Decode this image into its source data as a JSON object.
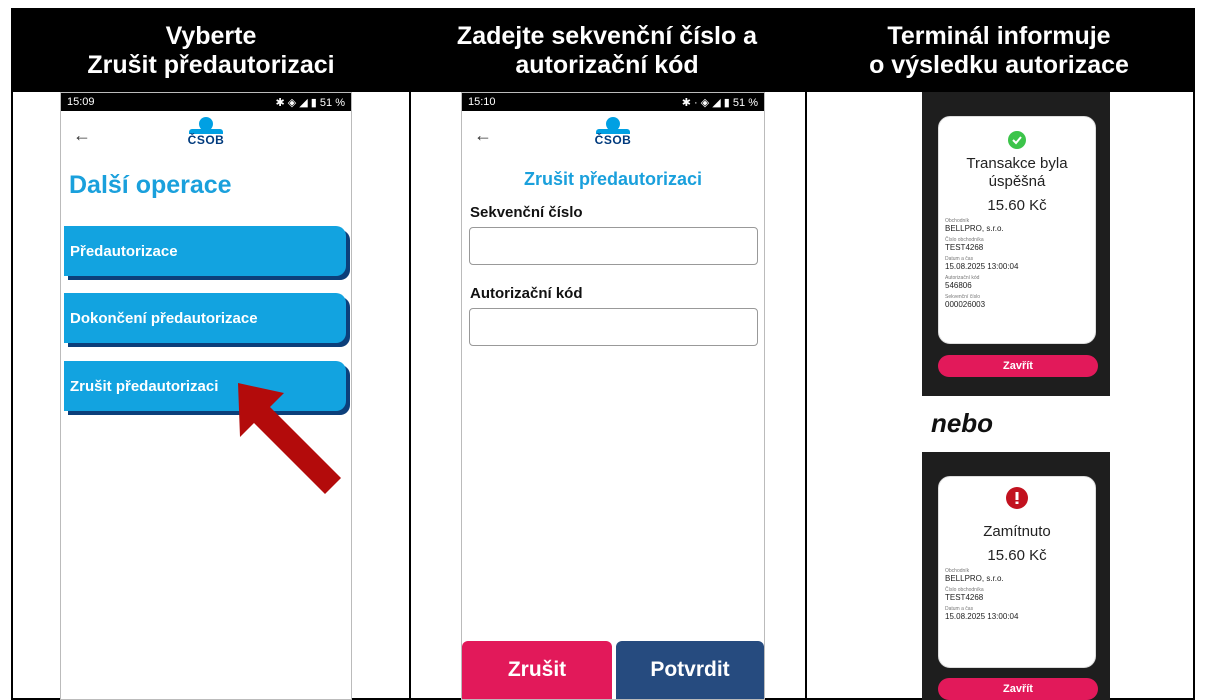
{
  "columns": {
    "col1": {
      "line1": "Vyberte",
      "line2": "Zrušit předautorizaci"
    },
    "col2": {
      "line1": "Zadejte sekvenční číslo a",
      "line2": "autorizační kód"
    },
    "col3": {
      "line1": "Terminál informuje",
      "line2": "o výsledku autorizace"
    }
  },
  "phone1": {
    "time": "15:09",
    "status_icons": "✱ ◈ ◢ ▮ 51 %",
    "logo": "ČSOB",
    "title": "Další operace",
    "menu": [
      {
        "label": "Předautorizace"
      },
      {
        "label": "Dokončení předautorizace"
      },
      {
        "label": "Zrušit předautorizaci"
      }
    ]
  },
  "phone2": {
    "time": "15:10",
    "status_icons": "✱ · ◈ ◢ ▮ 51 %",
    "logo": "ČSOB",
    "title": "Zrušit předautorizaci",
    "field1_label": "Sekvenční číslo",
    "field2_label": "Autorizační kód",
    "cancel_label": "Zrušit",
    "confirm_label": "Potvrdit"
  },
  "terminal_success": {
    "message_line1": "Transakce byla",
    "message_line2": "úspěšná",
    "amount": "15.60 Kč",
    "fields": [
      {
        "key": "Obchodník",
        "value": "BELLPRO, s.r.o."
      },
      {
        "key": "Číslo obchodníka",
        "value": "TEST4268"
      },
      {
        "key": "Datum a čas",
        "value": "15.08.2025 13:00:04"
      },
      {
        "key": "Autorizační kód",
        "value": "546806"
      },
      {
        "key": "Sekvenční číslo",
        "value": "000026003"
      }
    ],
    "close_label": "Zavřít"
  },
  "separator": "nebo",
  "terminal_declined": {
    "message": "Zamítnuto",
    "amount": "15.60 Kč",
    "fields": [
      {
        "key": "Obchodník",
        "value": "BELLPRO, s.r.o."
      },
      {
        "key": "Číslo obchodníka",
        "value": "TEST4268"
      },
      {
        "key": "Datum a čas",
        "value": "15.08.2025 13:00:04"
      }
    ],
    "close_label": "Zavřít"
  },
  "colors": {
    "accent": "#12a3e0",
    "cancel": "#e2195a",
    "confirm": "#264b7f",
    "arrow": "#b30b0b"
  }
}
